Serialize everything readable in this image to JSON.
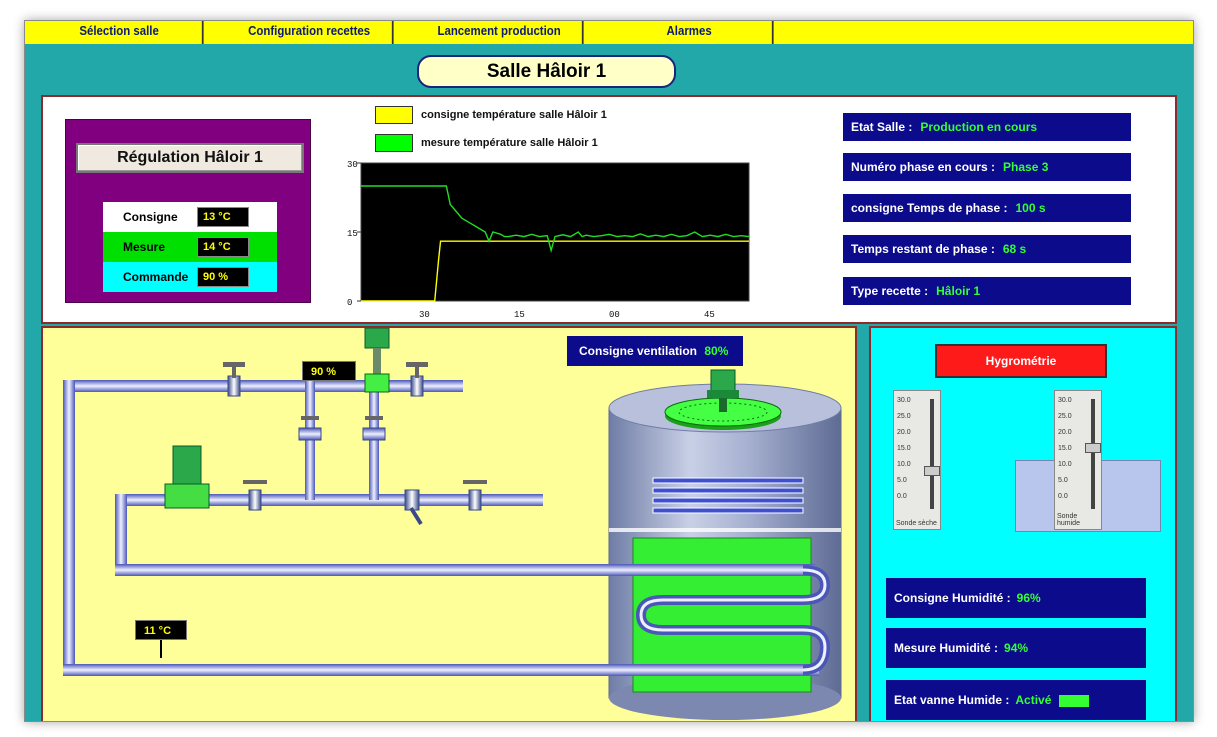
{
  "menu": [
    "Sélection salle",
    "Configuration recettes",
    "Lancement production",
    "Alarmes"
  ],
  "page_title": "Salle Hâloir 1",
  "regulation": {
    "title": "Régulation Hâloir 1",
    "rows": [
      {
        "label": "Consigne",
        "value": "13 °C",
        "color": "#ffffff"
      },
      {
        "label": "Mesure",
        "value": "14 °C",
        "color": "#00e000"
      },
      {
        "label": "Commande",
        "value": "90 %",
        "color": "#00ffff"
      }
    ]
  },
  "legend": {
    "setpoint": {
      "label": "consigne température salle Hâloir 1",
      "color": "#ffff00"
    },
    "measure": {
      "label": "mesure température salle Hâloir 1",
      "color": "#00ff00"
    }
  },
  "chart_data": {
    "type": "line",
    "ylim": [
      0,
      30
    ],
    "y_ticks": [
      "30",
      "15",
      "0"
    ],
    "x_ticks": [
      "30",
      "15",
      "00",
      "45"
    ],
    "series": [
      {
        "name": "consigne température salle Hâloir 1",
        "color": "#ffff00",
        "x": [
          0,
          19,
          20,
          20.5,
          100
        ],
        "y": [
          0,
          0,
          9,
          13,
          13
        ]
      },
      {
        "name": "mesure température salle Hâloir 1",
        "color": "#22dd22",
        "x": [
          0,
          22,
          23,
          24,
          26,
          28,
          30,
          32,
          33,
          34,
          36,
          37,
          38,
          40,
          42,
          44,
          46,
          48,
          49,
          50,
          52,
          54,
          56,
          57,
          58,
          60,
          62,
          64,
          66,
          68,
          70,
          72,
          74,
          76,
          78,
          80,
          82,
          84,
          86,
          88,
          90,
          92,
          94,
          96,
          98,
          100
        ],
        "y": [
          25,
          25,
          21,
          20,
          18,
          17,
          16,
          15,
          13,
          15,
          14.5,
          14,
          14,
          14.3,
          14,
          14.5,
          14,
          14.2,
          11,
          14,
          14.4,
          14,
          15,
          14,
          14.3,
          14,
          14.2,
          14.5,
          14,
          14.2,
          14,
          14.6,
          14,
          14.3,
          14,
          14.5,
          14,
          14.2,
          15,
          14,
          14.3,
          14,
          14.5,
          14,
          14.2,
          14
        ]
      }
    ]
  },
  "info": [
    {
      "label": "Etat Salle :",
      "value": "Production en cours"
    },
    {
      "label": "Numéro phase en cours :",
      "value": "Phase 3"
    },
    {
      "label": "consigne Temps de phase :",
      "value": "100 s"
    },
    {
      "label": "Temps restant de phase :",
      "value": "68 s"
    },
    {
      "label": "Type recette :",
      "value": "Hâloir 1"
    }
  ],
  "process": {
    "valve_command": "90 %",
    "return_temp": "11 °C",
    "ventilation": {
      "label": "Consigne ventilation",
      "value": "80%"
    }
  },
  "hygrometry": {
    "button": "Hygrométrie",
    "scale": [
      "30.0",
      "25.0",
      "20.0",
      "15.0",
      "10.0",
      "5.0",
      "0.0"
    ],
    "dry_probe": {
      "label": "Sonde sèche",
      "level": 0.33
    },
    "wet_probe": {
      "label": "Sonde humide",
      "level": 0.56
    },
    "rows": [
      {
        "label": "Consigne Humidité :",
        "value": "96%"
      },
      {
        "label": "Mesure Humidité :",
        "value": "94%"
      },
      {
        "label": "Etat vanne Humide :",
        "value": "Activé"
      }
    ]
  },
  "colors": {
    "accent": "#0b0b8c",
    "ok": "#33ff33",
    "alarm": "#ff1a1a",
    "tank": "#9aa6c4"
  }
}
